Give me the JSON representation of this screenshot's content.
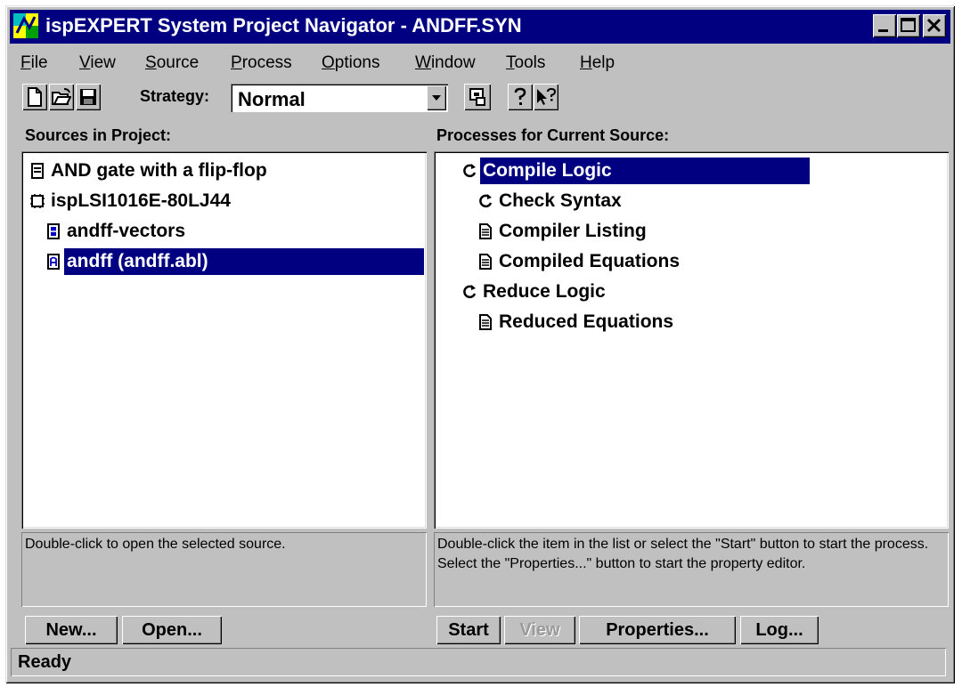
{
  "window": {
    "title": "ispEXPERT System Project Navigator - ANDFF.SYN"
  },
  "menu": {
    "items": [
      {
        "accel": "F",
        "rest": "ile"
      },
      {
        "accel": "V",
        "rest": "iew"
      },
      {
        "accel": "S",
        "rest": "ource"
      },
      {
        "accel": "P",
        "rest": "rocess"
      },
      {
        "accel": "O",
        "rest": "ptions"
      },
      {
        "accel": "W",
        "rest": "indow"
      },
      {
        "accel": "T",
        "rest": "ools"
      },
      {
        "accel": "H",
        "rest": "elp"
      }
    ]
  },
  "toolbar": {
    "strategy_label": "Strategy:",
    "strategy_value": "Normal",
    "icons": [
      "new-file-icon",
      "open-folder-icon",
      "save-disk-icon",
      "chip-config-icon",
      "help-icon",
      "context-help-icon"
    ]
  },
  "sources": {
    "label": "Sources in Project:",
    "items": [
      {
        "label": "AND gate with a flip-flop",
        "icon": "document-icon",
        "selected": false
      },
      {
        "label": "ispLSI1016E-80LJ44",
        "icon": "chip-icon",
        "selected": false
      },
      {
        "label": "andff-vectors",
        "icon": "vectors-file-icon",
        "selected": false
      },
      {
        "label": "andff (andff.abl)",
        "icon": "abel-file-icon",
        "selected": true
      }
    ],
    "hint": "Double-click to open the selected source.",
    "buttons": {
      "new": "New...",
      "open": "Open..."
    }
  },
  "processes": {
    "label": "Processes for Current Source:",
    "items": [
      {
        "label": "Compile Logic",
        "icon": "process-cycle-icon",
        "selected": true
      },
      {
        "label": "Check Syntax",
        "icon": "process-cycle-icon",
        "selected": false
      },
      {
        "label": "Compiler Listing",
        "icon": "report-icon",
        "selected": false
      },
      {
        "label": "Compiled Equations",
        "icon": "report-icon",
        "selected": false
      },
      {
        "label": "Reduce Logic",
        "icon": "process-cycle-icon",
        "selected": false
      },
      {
        "label": "Reduced Equations",
        "icon": "report-icon",
        "selected": false
      }
    ],
    "hint": "Double-click the item in the list or select the \"Start\" button to start the process.  Select the \"Properties...\" button to start the property editor.",
    "buttons": {
      "start": "Start",
      "view": "View",
      "properties": "Properties...",
      "log": "Log..."
    }
  },
  "status": {
    "text": "Ready"
  },
  "colors": {
    "title_bar": "#000080",
    "face": "#c0c0c0",
    "selection": "#000080"
  }
}
